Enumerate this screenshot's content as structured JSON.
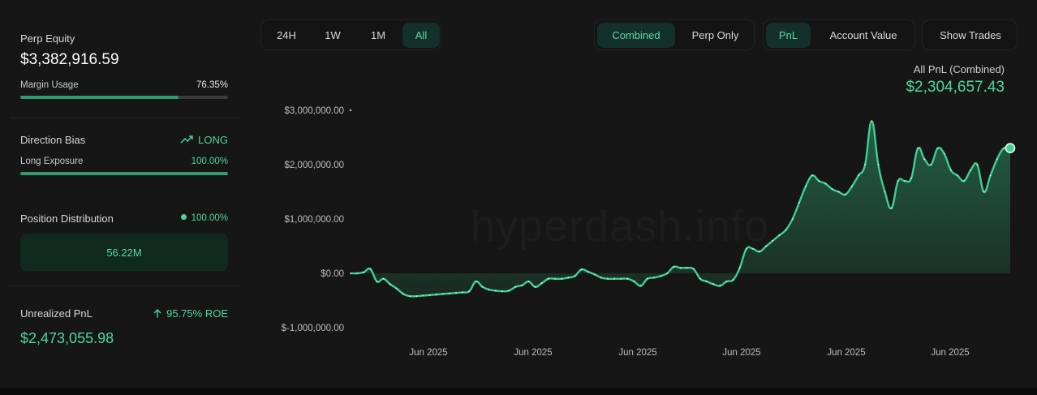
{
  "left_panel": {
    "perp_equity_label": "Perp Equity",
    "perp_equity_value": "$3,382,916.59",
    "margin_usage_label": "Margin Usage",
    "margin_usage_value": "76.35%",
    "margin_usage_fraction": 0.7635,
    "direction_bias_label": "Direction Bias",
    "direction_bias_value": "LONG",
    "long_exposure_label": "Long Exposure",
    "long_exposure_value": "100.00%",
    "long_exposure_fraction": 1.0,
    "position_distribution_label": "Position Distribution",
    "position_distribution_value": "100.00%",
    "position_distribution_amount": "56.22M",
    "unrealized_pnl_label": "Unrealized PnL",
    "unrealized_pnl_roe": "95.75% ROE",
    "unrealized_pnl_value": "$2,473,055.98"
  },
  "toolbar": {
    "timeframes": [
      "24H",
      "1W",
      "1M",
      "All"
    ],
    "active_timeframe": "All",
    "modes": [
      "Combined",
      "Perp Only"
    ],
    "active_mode": "Combined",
    "metrics": [
      "PnL",
      "Account Value"
    ],
    "active_metric": "PnL",
    "show_trades_label": "Show Trades"
  },
  "pnl_header": {
    "title": "All PnL (Combined)",
    "value": "$2,304,657.43"
  },
  "watermark": "hyperdash.info",
  "colors": {
    "accent": "#4fd69c",
    "line": "#3fcf90",
    "background": "#161616"
  },
  "chart_data": {
    "type": "area",
    "title": "All PnL (Combined)",
    "xlabel": "",
    "ylabel": "",
    "ylim": [
      -1000000,
      3000000
    ],
    "yticks": [
      3000000,
      2000000,
      1000000,
      0,
      -1000000
    ],
    "ytick_labels": [
      "$3,000,000.00",
      "$2,000,000.00",
      "$1,000,000.00",
      "$0.00",
      "$-1,000,000.00"
    ],
    "xtick_labels": [
      "Jun 2025",
      "Jun 2025",
      "Jun 2025",
      "Jun 2025",
      "Jun 2025",
      "Jun 2025"
    ],
    "grid": false,
    "legend": "none",
    "series": [
      {
        "values": [
          0,
          0,
          20000,
          80000,
          -150000,
          -100000,
          -200000,
          -280000,
          -380000,
          -420000,
          -420000,
          -410000,
          -400000,
          -390000,
          -380000,
          -370000,
          -360000,
          -350000,
          -330000,
          -150000,
          -250000,
          -300000,
          -320000,
          -330000,
          -320000,
          -250000,
          -220000,
          -150000,
          -250000,
          -180000,
          -100000,
          -100000,
          -100000,
          -80000,
          -50000,
          70000,
          30000,
          -20000,
          -80000,
          -100000,
          -100000,
          -100000,
          -100000,
          -150000,
          -230000,
          -100000,
          -80000,
          -50000,
          0,
          120000,
          100000,
          100000,
          80000,
          -100000,
          -150000,
          -200000,
          -230000,
          -150000,
          -120000,
          100000,
          450000,
          450000,
          400000,
          500000,
          600000,
          700000,
          800000,
          1000000,
          1300000,
          1600000,
          1800000,
          1700000,
          1650000,
          1550000,
          1500000,
          1450000,
          1600000,
          1800000,
          2000000,
          2800000,
          2000000,
          1500000,
          1200000,
          1700000,
          1700000,
          1750000,
          2300000,
          2100000,
          2000000,
          2300000,
          2200000,
          1900000,
          1800000,
          1700000,
          1900000,
          2000000,
          1500000,
          1800000,
          2100000,
          2300000,
          2304657
        ]
      }
    ]
  }
}
